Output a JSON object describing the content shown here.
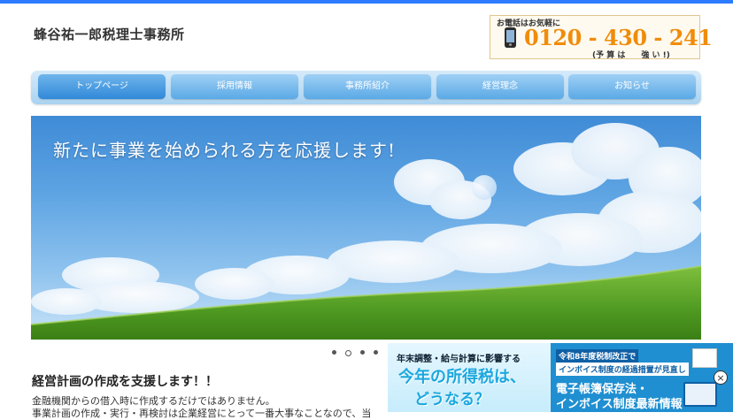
{
  "header": {
    "logo_text": "蜂谷祐一郎税理士事務所",
    "phone_caption": "お電話はお気軽に",
    "phone_number": "0120 - 430 - 241",
    "phone_note": "(予 算 は　　強 い !)"
  },
  "nav": {
    "items": [
      {
        "label": "トップページ",
        "active": true
      },
      {
        "label": "採用情報",
        "active": false
      },
      {
        "label": "事務所紹介",
        "active": false
      },
      {
        "label": "経営理念",
        "active": false
      },
      {
        "label": "お知らせ",
        "active": false
      }
    ]
  },
  "hero": {
    "title": "新たに事業を始められる方を応援します!"
  },
  "slider": {
    "count": 4,
    "active_index": 1
  },
  "content": {
    "section_title": "経営計画の作成を支援します！！",
    "line1": "金融機関からの借入時に作成するだけではありません。",
    "line2": "事業計画の作成・実行・再検討は企業経営にとって一番大事なことなので、当"
  },
  "ad": {
    "left_line1": "年末調整・給与計算に影響する",
    "left_line2": "今年の所得税は、",
    "left_line3": "どうなる？",
    "right_line1": "令和8年度税制改正で",
    "right_line2": "インボイス制度の経過措置が見直し",
    "right_line3": "電子帳簿保存法・",
    "right_line4": "インボイス制度最新情報",
    "close_icon": "×"
  },
  "colors": {
    "accent_blue": "#2d7cff",
    "phone_orange": "#f08c0a",
    "nav_blue": "#5aa9e6"
  }
}
